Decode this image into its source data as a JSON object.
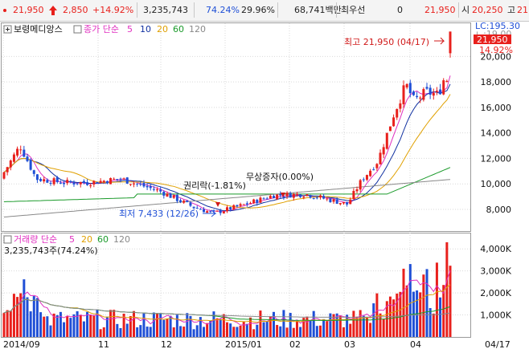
{
  "ticker_bar": {
    "price": "21,950",
    "change": "2,850",
    "change_pct": "+14.92%",
    "volume": "3,235,743",
    "volume_ratio": "74.24%",
    "turnover": "29.96%",
    "trade_value": "68,741백만",
    "preferred_label": "최우선",
    "preferred_value": "0",
    "ask": "21,950",
    "open_label": "시",
    "open": "20,250",
    "high_label": "고",
    "high_value": "21"
  },
  "price_panel": {
    "stock_name": "보령메디앙스",
    "ma_label": "종가 단순",
    "ma_periods": [
      "5",
      "10",
      "20",
      "60",
      "120"
    ],
    "lc_label": "LC:195.30",
    "hidden_label": "ㄴ:19.00",
    "current_tag": "21,950",
    "current_pct": "14.92%",
    "high_annotation": "최고 21,950 (04/17)",
    "low_annotation": "최저 7,433 (12/26)",
    "event_rights": "권리락(-1.81%)",
    "event_bonus": "무상증자(0.00%)"
  },
  "volume_panel": {
    "title": "거래량 단순",
    "ma_periods": [
      "5",
      "20",
      "60",
      "120"
    ],
    "current_volume": "3,235,743주(74.24%)"
  },
  "x_axis": {
    "labels": [
      "2014/09",
      "11",
      "12",
      "2015/01",
      "02",
      "03",
      "04"
    ],
    "last_date": "04/17"
  },
  "colors": {
    "up": "#e8201c",
    "down": "#1f4fd6",
    "ma5": "#e030c0",
    "ma10": "#1030a0",
    "ma20": "#e0a000",
    "ma60": "#1a9a2a",
    "ma120": "#888888",
    "grid": "#d9d9d9"
  },
  "chart_data": {
    "type": "candlestick",
    "price_axis": {
      "ticks": [
        8000,
        10000,
        12000,
        14000,
        16000,
        18000,
        20000
      ],
      "ylim": [
        6300,
        22600
      ]
    },
    "volume_axis": {
      "ticks": [
        "1,000K",
        "2,000K",
        "3,000K",
        "4,000K"
      ],
      "values": [
        1000000,
        2000000,
        3000000,
        4000000
      ],
      "ylim": [
        0,
        4700000
      ]
    },
    "annotations": [
      {
        "text": "최고 21,950 (04/17)",
        "value": 21950
      },
      {
        "text": "최저 7,433 (12/26)",
        "value": 7433
      }
    ]
  }
}
